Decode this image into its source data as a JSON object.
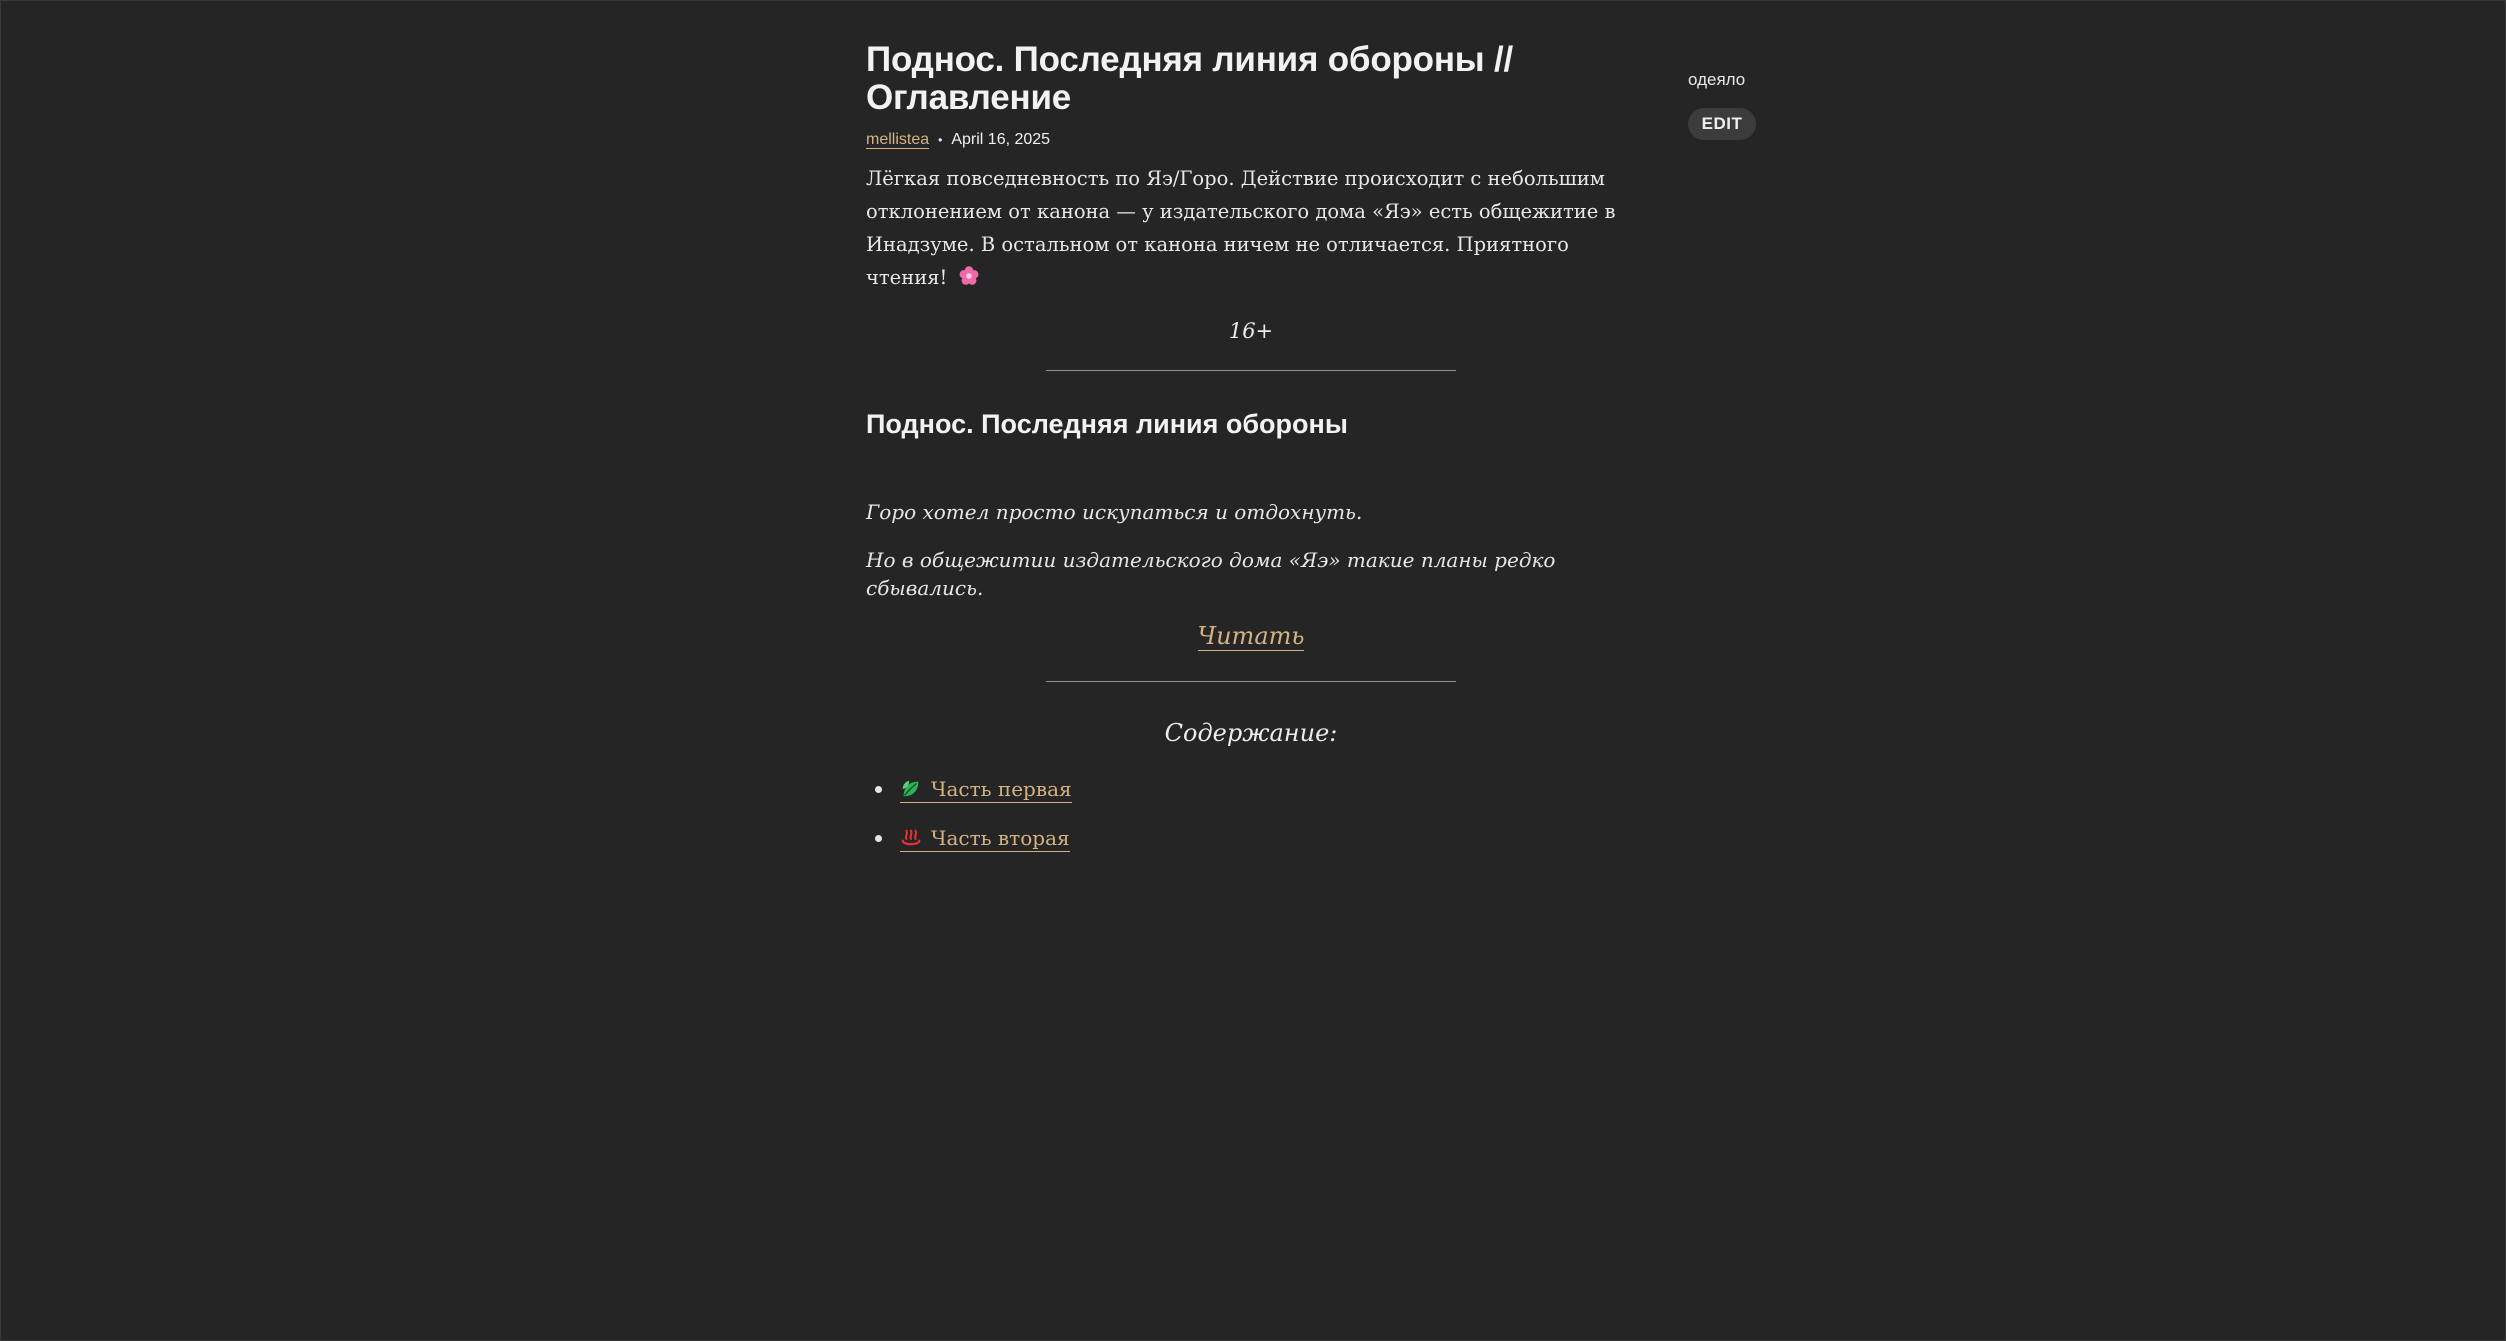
{
  "article": {
    "title": "Поднос. Последняя линия обороны // Оглавление",
    "author": "mellistea",
    "date": "April 16, 2025",
    "summary": "Лёгкая повседневность по Яэ/Горо. Действие происходит с небольшим отклонением от канона — у издательского дома «Яэ» есть общежитие в Инадзуме. В остальном от канона ничем не отличается. Приятного чтения!",
    "summary_icon": "cherry-blossom-icon",
    "rating": "16+",
    "section_title": "Поднос. Последняя линия обороны",
    "excerpt_1": "Горо хотел просто искупаться и отдохнуть.",
    "excerpt_2": "Но в общежитии издательского дома «Яэ» такие планы редко сбывались.",
    "read_label": "Читать",
    "toc_title": "Содержание:",
    "toc": [
      {
        "label": "Часть первая",
        "icon": "leaf-icon"
      },
      {
        "label": "Часть вторая",
        "icon": "hot-springs-icon"
      }
    ]
  },
  "sidebar": {
    "tag": "одеяло",
    "edit_label": "EDIT"
  },
  "colors": {
    "background": "#252525",
    "text": "#e6e6e6",
    "link": "#d4b382",
    "button_bg": "#3c3c3c"
  }
}
